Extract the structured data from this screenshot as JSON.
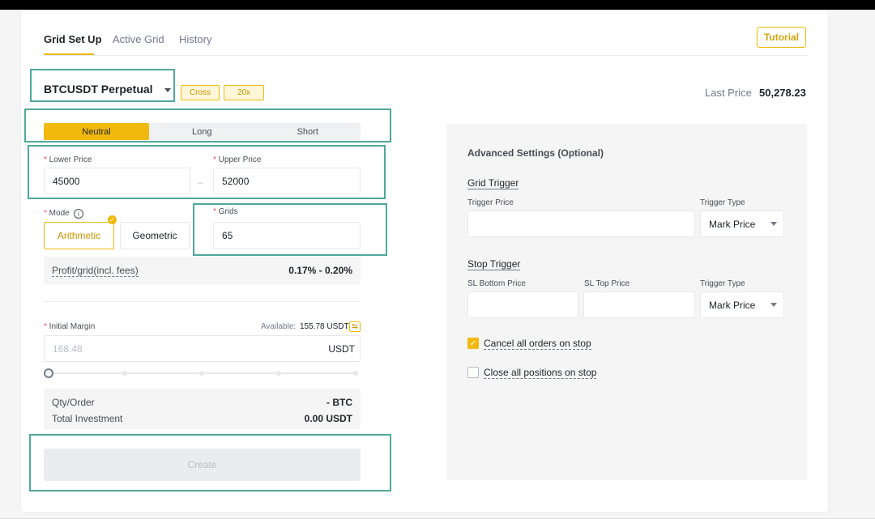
{
  "tabs": [
    {
      "label": "Grid Set Up",
      "active": true
    },
    {
      "label": "Active Grid",
      "active": false
    },
    {
      "label": "History",
      "active": false
    }
  ],
  "tutorial_label": "Tutorial",
  "symbol": {
    "name": "BTCUSDT Perpetual",
    "margin_mode": "Cross",
    "leverage": "20x"
  },
  "last_price": {
    "label": "Last Price",
    "value": "50,278.23"
  },
  "direction": {
    "options": [
      "Neutral",
      "Long",
      "Short"
    ],
    "selected": "Neutral"
  },
  "price_range": {
    "lower": {
      "label": "Lower Price",
      "value": "45000"
    },
    "separator": "–",
    "upper": {
      "label": "Upper Price",
      "value": "52000"
    }
  },
  "mode": {
    "label": "Mode",
    "options": [
      "Arithmetic",
      "Geometric"
    ],
    "selected": "Arithmetic"
  },
  "grids": {
    "label": "Grids",
    "value": "65"
  },
  "profit": {
    "label": "Profit/grid(incl. fees)",
    "value": "0.17% - 0.20%"
  },
  "initial_margin": {
    "label": "Initial Margin",
    "available_label": "Available:",
    "available_value": "155.78 USDT",
    "placeholder": "168.48",
    "unit": "USDT",
    "slider_percent": 0
  },
  "summary": {
    "qty_label": "Qty/Order",
    "qty_value": "- BTC",
    "investment_label": "Total Investment",
    "investment_value": "0.00 USDT"
  },
  "create_label": "Create",
  "advanced": {
    "title": "Advanced Settings (Optional)",
    "grid_trigger": {
      "title": "Grid Trigger",
      "trigger_price_label": "Trigger Price",
      "trigger_type_label": "Trigger Type",
      "trigger_type_value": "Mark Price"
    },
    "stop_trigger": {
      "title": "Stop Trigger",
      "sl_bottom_label": "SL Bottom Price",
      "sl_top_label": "SL Top Price",
      "trigger_type_label": "Trigger Type",
      "trigger_type_value": "Mark Price"
    },
    "cancel_orders": {
      "label": "Cancel all orders on stop",
      "checked": true
    },
    "close_positions": {
      "label": "Close all positions on stop",
      "checked": false
    }
  },
  "colors": {
    "accent": "#f0b90b",
    "highlight": "#4fa89c"
  },
  "icons": [
    "chevron-down-icon",
    "info-icon",
    "check-icon",
    "transfer-icon"
  ]
}
